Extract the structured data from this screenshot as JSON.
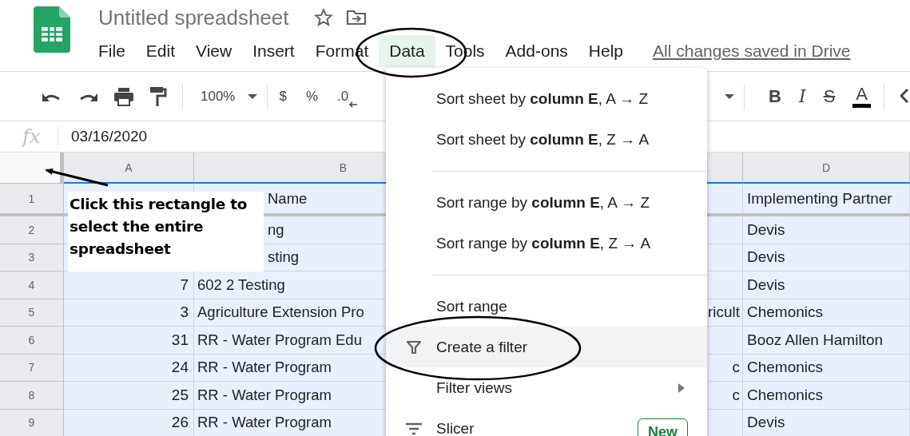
{
  "app": {
    "title": "Untitled spreadsheet",
    "save_status": "All changes saved in Drive"
  },
  "menu_bar": [
    {
      "label": "File",
      "selected": false
    },
    {
      "label": "Edit",
      "selected": false
    },
    {
      "label": "View",
      "selected": false
    },
    {
      "label": "Insert",
      "selected": false
    },
    {
      "label": "Format",
      "selected": false
    },
    {
      "label": "Data",
      "selected": true
    },
    {
      "label": "Tools",
      "selected": false
    },
    {
      "label": "Add-ons",
      "selected": false
    },
    {
      "label": "Help",
      "selected": false
    }
  ],
  "toolbar": {
    "zoom": "100%",
    "currency": "$",
    "percent": "%",
    "decimal": ".0",
    "text_format": [
      {
        "kind": "bold",
        "label": "B"
      },
      {
        "kind": "italic",
        "label": "I"
      },
      {
        "kind": "strike",
        "label": "S"
      },
      {
        "kind": "color",
        "label": "A"
      }
    ]
  },
  "formula_bar": {
    "label": "fx",
    "value": "03/16/2020"
  },
  "columns": [
    "A",
    "B",
    "D"
  ],
  "rows": [
    {
      "number": "1",
      "frozen": true,
      "b": {
        "text": "Name",
        "covered": true
      },
      "d": "Implementing Partner"
    },
    {
      "number": "2",
      "frozen": false,
      "b": {
        "text": "ng",
        "covered": true
      },
      "d": "Devis"
    },
    {
      "number": "3",
      "frozen": false,
      "b": {
        "text": "sting",
        "covered": true
      },
      "d": "Devis"
    },
    {
      "number": "4",
      "frozen": false,
      "a": "7",
      "b": {
        "text": "602 2 Testing",
        "covered": false
      },
      "d": "Devis"
    },
    {
      "number": "5",
      "frozen": false,
      "a": "3",
      "b": {
        "text": "Agriculture Extension Pro",
        "covered": false
      },
      "column_3": "ricult",
      "d": "Chemonics"
    },
    {
      "number": "6",
      "frozen": false,
      "a": "31",
      "b": {
        "text": "RR - Water Program Edu",
        "covered": false
      },
      "d": "Booz Allen Hamilton"
    },
    {
      "number": "7",
      "frozen": false,
      "a": "24",
      "b": {
        "text": "RR - Water Program",
        "covered": false
      },
      "column_3": "c",
      "d": "Chemonics"
    },
    {
      "number": "8",
      "frozen": false,
      "a": "25",
      "b": {
        "text": "RR - Water Program",
        "covered": false
      },
      "column_3": "c",
      "d": "Chemonics"
    },
    {
      "number": "9",
      "frozen": false,
      "a": "26",
      "b": {
        "text": "RR - Water Program",
        "covered": false
      },
      "d": "Devis"
    }
  ],
  "data_menu": [
    {
      "kind": "plain",
      "label": "Sort sheet by **column E**, A → Z",
      "selected": false
    },
    {
      "kind": "plain",
      "label": "Sort sheet by **column E**, Z → A",
      "selected": false
    },
    {
      "kind": "divider"
    },
    {
      "kind": "plain",
      "label": "Sort range by **column E**, A → Z",
      "selected": false
    },
    {
      "kind": "plain",
      "label": "Sort range by **column E**, Z → A",
      "selected": false
    },
    {
      "kind": "divider"
    },
    {
      "kind": "plain",
      "label": "Sort range",
      "selected": false
    },
    {
      "kind": "filter",
      "label": "Create a filter",
      "selected": true
    },
    {
      "kind": "submenu",
      "label": "Filter views",
      "selected": false
    },
    {
      "kind": "slicer",
      "label": "Slicer",
      "badge": "New",
      "selected": false
    }
  ],
  "callout": {
    "text": "Click this rectangle to select the entire spreadsheet"
  }
}
